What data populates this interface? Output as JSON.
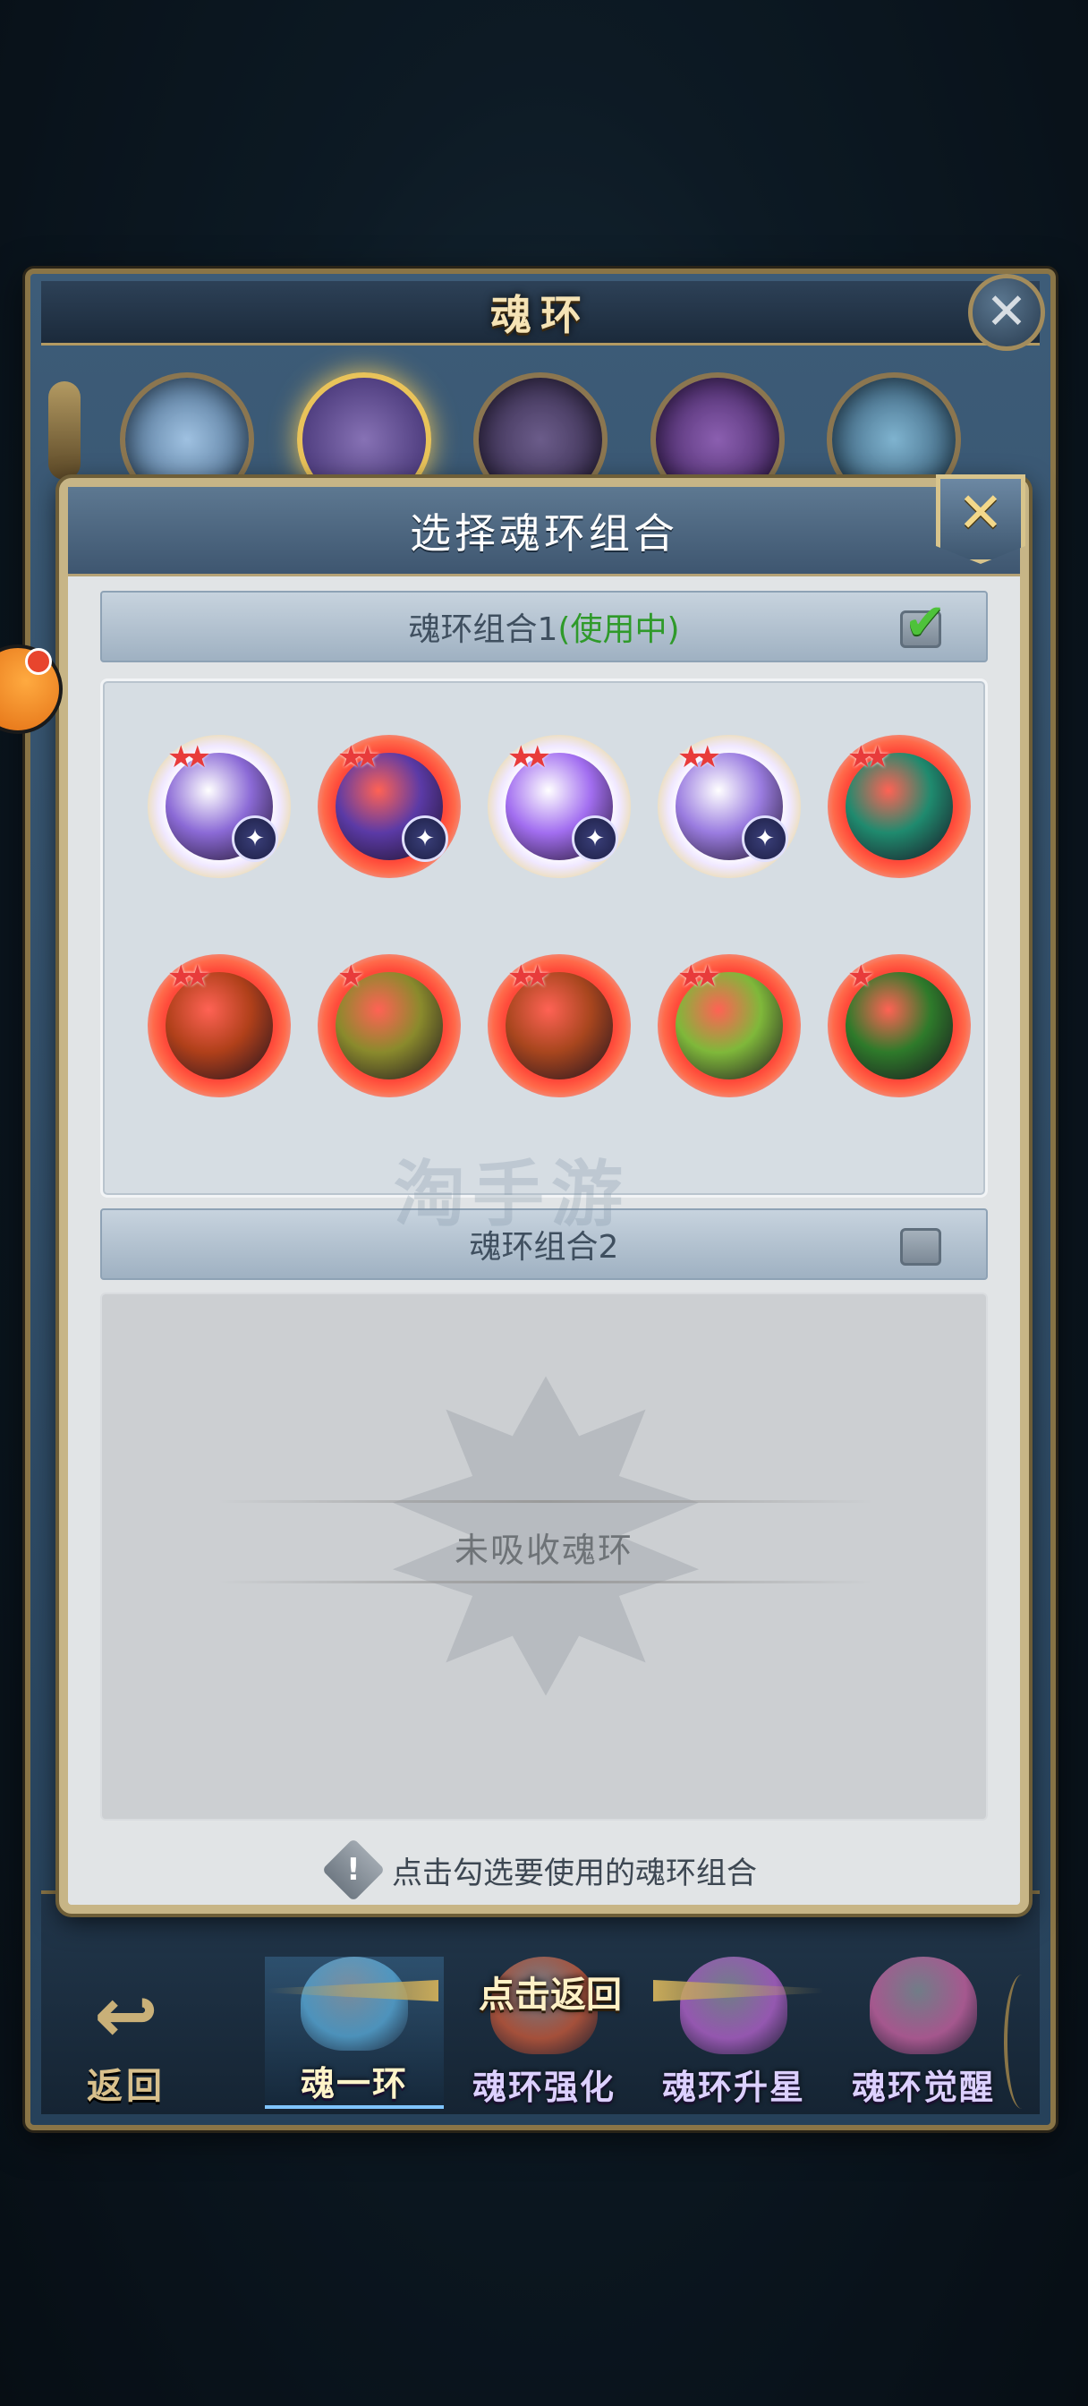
{
  "outer": {
    "title": "魂环",
    "close_symbol": "✕",
    "hero_count": 5
  },
  "dialog": {
    "title": "选择魂环组合",
    "close_symbol": "✕",
    "set1": {
      "name": "魂环组合1",
      "status": "(使用中)",
      "checked": true,
      "check_symbol": "✔"
    },
    "set2": {
      "name": "魂环组合2",
      "checked": false
    },
    "empty_text": "未吸收魂环",
    "hint": "点击勾选要使用的魂环组合",
    "hint_symbol": "!"
  },
  "rings": [
    {
      "icon": "purple-spider-ring-icon",
      "frame": "white",
      "stars": 2,
      "has_badge": true,
      "orb_color": "#8b6ad6"
    },
    {
      "icon": "purple-beast-ring-icon",
      "frame": "red",
      "stars": 2,
      "has_badge": true,
      "orb_color": "#5b3aa6"
    },
    {
      "icon": "purple-lightning-ring-icon",
      "frame": "white",
      "stars": 2,
      "has_badge": true,
      "orb_color": "#a26ef0"
    },
    {
      "icon": "purple-hexagon-ring-icon",
      "frame": "white",
      "stars": 2,
      "has_badge": true,
      "orb_color": "#9a7ce0"
    },
    {
      "icon": "green-wings-ring-icon",
      "frame": "red",
      "stars": 2,
      "has_badge": false,
      "orb_color": "#1f8a6e"
    },
    {
      "icon": "fire-warrior-ring-icon",
      "frame": "red",
      "stars": 2,
      "has_badge": false,
      "orb_color": "#b0401a"
    },
    {
      "icon": "olive-leaf-ring-icon",
      "frame": "red",
      "stars": 1,
      "has_badge": false,
      "orb_color": "#8a8a2c"
    },
    {
      "icon": "fire-serpent-ring-icon",
      "frame": "red",
      "stars": 2,
      "has_badge": false,
      "orb_color": "#a8461e"
    },
    {
      "icon": "green-wind-ring-icon",
      "frame": "red",
      "stars": 2,
      "has_badge": false,
      "orb_color": "#7fb83a"
    },
    {
      "icon": "sprout-ring-icon",
      "frame": "red",
      "stars": 1,
      "has_badge": false,
      "orb_color": "#2e7a2a"
    }
  ],
  "badge_symbol": "✦",
  "star_symbol": "★",
  "bottom_bar": {
    "back_label": "返回",
    "back_symbol": "↩",
    "return_tip": "点击返回",
    "tabs": [
      {
        "label": "魂一环",
        "active": true,
        "gem_color": "#5fb6e6"
      },
      {
        "label": "魂环强化",
        "active": false,
        "gem_color": "#e0603a"
      },
      {
        "label": "魂环升星",
        "active": false,
        "gem_color": "#c86ae0"
      },
      {
        "label": "魂环觉醒",
        "active": false,
        "gem_color": "#e06ab0"
      }
    ]
  },
  "watermark": "淘手游"
}
